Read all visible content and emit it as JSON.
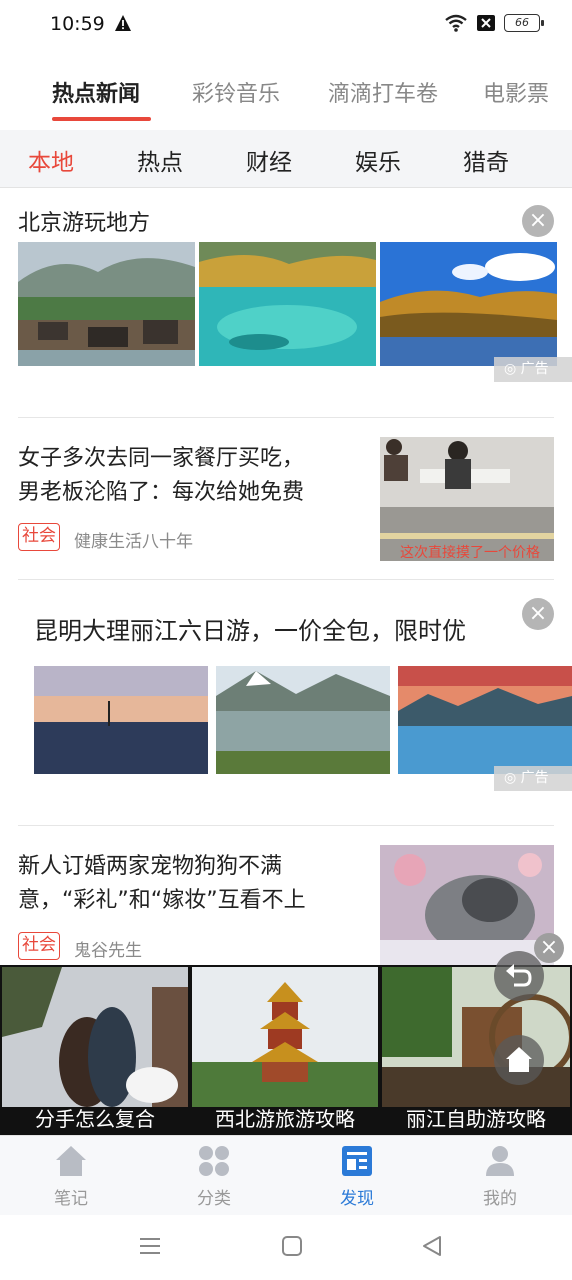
{
  "status_bar": {
    "time": "10:59",
    "battery": "66"
  },
  "top_tabs": [
    "热点新闻",
    "彩铃音乐",
    "滴滴打车卷",
    "电影票"
  ],
  "sub_tabs": [
    "本地",
    "热点",
    "财经",
    "娱乐",
    "猎奇"
  ],
  "feed": {
    "ad1": {
      "title": "北京游玩地方",
      "ad_label": "广告",
      "close": "×"
    },
    "news1": {
      "title_line1": "女子多次去同一家餐厅买吃，",
      "title_line2": "男老板沦陷了：每次给她免费",
      "tag": "社会",
      "source": "健康生活八十年",
      "thumb_caption": "这次直接摸了一个价格"
    },
    "ad2": {
      "title": "昆明大理丽江六日游，一价全包，限时优",
      "ad_label": "广告",
      "close": "×"
    },
    "news2": {
      "title_line1": "新人订婚两家宠物狗狗不满",
      "title_line2": "意，“彩礼”和“嫁妆”互看不上",
      "tag": "社会",
      "source": "鬼谷先生"
    }
  },
  "banner": {
    "captions": [
      "分手怎么复合",
      "西北游旅游攻略",
      "丽江自助游攻略"
    ],
    "close": "×"
  },
  "bottom_nav": [
    {
      "label": "笔记",
      "icon": "house-icon"
    },
    {
      "label": "分类",
      "icon": "grid-icon"
    },
    {
      "label": "发现",
      "icon": "news-icon"
    },
    {
      "label": "我的",
      "icon": "person-icon"
    }
  ],
  "colors": {
    "accent": "#e8483b",
    "nav_active": "#2b7ad7"
  }
}
